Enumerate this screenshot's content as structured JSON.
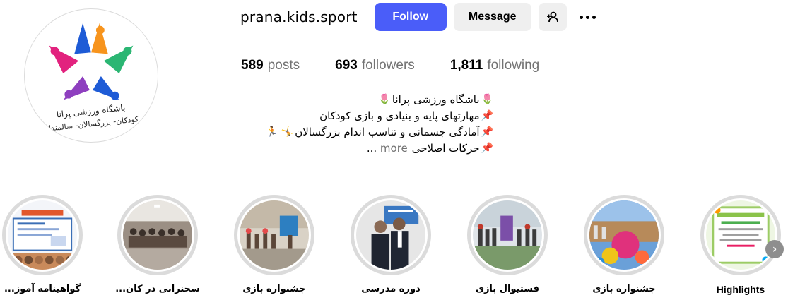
{
  "profile": {
    "username": "prana.kids.sport",
    "follow_label": "Follow",
    "message_label": "Message",
    "stats": {
      "posts_count": "589",
      "posts_label": "posts",
      "followers_count": "693",
      "followers_label": "followers",
      "following_count": "1,811",
      "following_label": "following"
    },
    "bio": {
      "line1": "باشگاه ورزشی پرانا",
      "line2": "مهارتهای پایه و بنیادی و بازی کودکان",
      "line3": "آمادگی جسمانی و تناسب اندام بزرگسالان",
      "line4": "حرکات اصلاحی",
      "more_prefix": "...",
      "more_label": "more"
    },
    "avatar_text": {
      "line1": "باشگاه ورزشی پرانا",
      "line2": "کودکان- بزرگسالان- سالمندان"
    }
  },
  "highlights": [
    {
      "label": "گواهینامه آموز...",
      "icon": "certificate-highlight"
    },
    {
      "label": "سخنرانی در کان...",
      "icon": "conference-highlight"
    },
    {
      "label": "جشنواره بازی",
      "icon": "festival-highlight"
    },
    {
      "label": "دوره مدرسی",
      "icon": "course-highlight"
    },
    {
      "label": "فستیوال بازی",
      "icon": "game-festival-highlight"
    },
    {
      "label": "جشنواره بازی",
      "icon": "festival-balls-highlight"
    },
    {
      "label": "Highlights",
      "icon": "highlights-highlight"
    }
  ],
  "icons": {
    "add_user": "add-user-icon",
    "more": "more-options-icon",
    "next": "chevron-right-icon"
  },
  "colors": {
    "follow_button": "#4a5df9",
    "secondary_button": "#efefef",
    "muted_text": "#737373",
    "highlight_ring": "#dbdbdb"
  }
}
